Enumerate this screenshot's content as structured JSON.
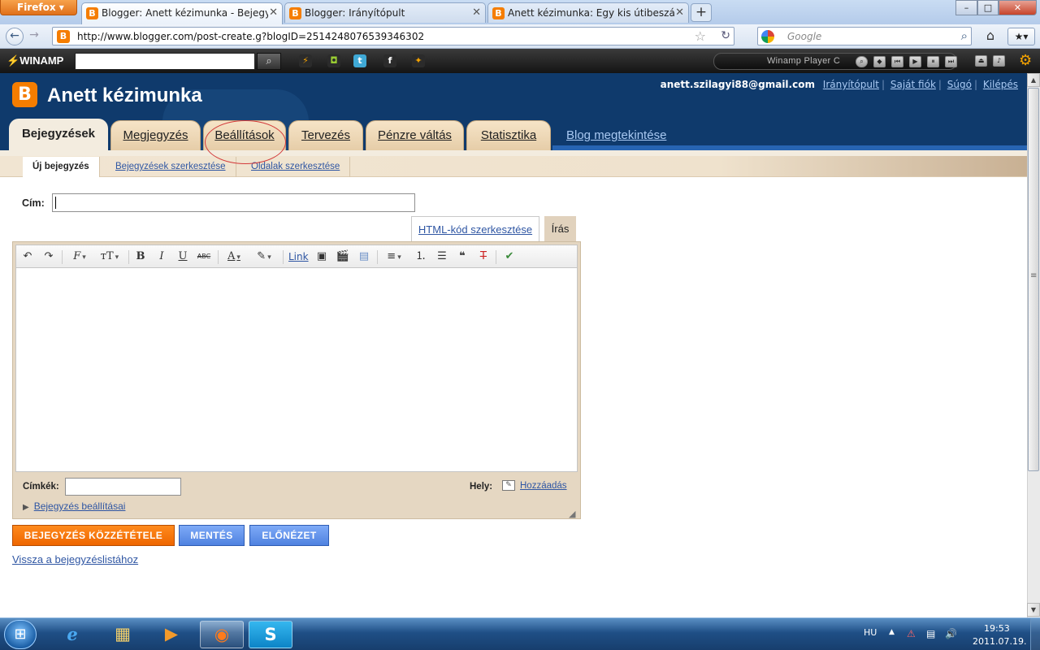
{
  "browser": {
    "menu_button": "Firefox",
    "tabs": [
      {
        "label": "Blogger: Anett kézimunka - Bejegyzés...",
        "active": true
      },
      {
        "label": "Blogger: Irányítópult",
        "active": false
      },
      {
        "label": "Anett kézimunka: Egy kis útibeszámol...",
        "active": false
      }
    ],
    "new_tab": "+",
    "window_controls": {
      "minimize": "–",
      "maximize": "□",
      "close": "✕"
    },
    "url": "http://www.blogger.com/post-create.g?blogID=2514248076539346302",
    "search_placeholder": "Google"
  },
  "winamp": {
    "logo": "WINAMP",
    "player_label": "Winamp Player C",
    "icons": [
      "winamp-icon",
      "android-icon",
      "twitter-icon",
      "facebook-icon",
      "runner-icon"
    ]
  },
  "blog": {
    "title": "Anett kézimunka",
    "user": {
      "email": "anett.szilagyi88@gmail.com",
      "links": [
        "Irányítópult",
        "Saját fiók",
        "Súgó",
        "Kilépés"
      ]
    },
    "main_tabs": [
      "Bejegyzések",
      "Megjegyzés",
      "Beállítások",
      "Tervezés",
      "Pénzre váltás",
      "Statisztika"
    ],
    "view_blog": "Blog megtekintése",
    "sub_tabs": [
      "Új bejegyzés",
      "Bejegyzések szerkesztése",
      "Oldalak szerkesztése"
    ]
  },
  "editor": {
    "title_label": "Cím:",
    "title_value": "",
    "mode_html": "HTML-kód szerkesztése",
    "mode_compose": "Írás",
    "toolbar": {
      "link": "Link",
      "bold": "B",
      "italic": "I",
      "underline": "U",
      "strike": "ABC",
      "text_color": "A"
    },
    "labels_label": "Címkék:",
    "labels_value": "",
    "place_label": "Hely:",
    "place_add": "Hozzáadás",
    "post_settings": "Bejegyzés beállításai"
  },
  "actions": {
    "publish": "BEJEGYZÉS KÖZZÉTÉTELE",
    "save": "MENTÉS",
    "preview": "ELŐNÉZET",
    "back": "Vissza a bejegyzéslistához"
  },
  "taskbar": {
    "language": "HU",
    "time": "19:53",
    "date": "2011.07.19."
  },
  "colors": {
    "header_bg": "#0f3a6c",
    "tab_bg": "#e6cda8",
    "publish": "#ee6600",
    "secondary_button": "#4f82e0",
    "link": "#2f56a3"
  }
}
